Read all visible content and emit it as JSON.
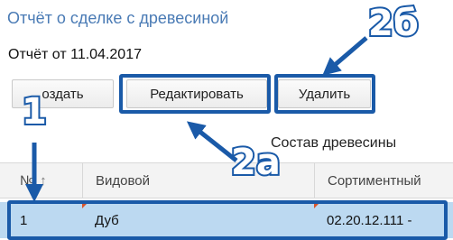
{
  "header": {
    "title": "Отчёт о сделке с древесиной",
    "report_date": "Отчёт от 11.04.2017"
  },
  "toolbar": {
    "create_label": "оздать",
    "edit_label": "Редактировать",
    "delete_label": "Удалить"
  },
  "section": {
    "title": "Состав древесины"
  },
  "table": {
    "columns": [
      "№",
      "Видовой",
      "Сортиментный"
    ],
    "sort_indicator": "↑",
    "rows": [
      {
        "num": "1",
        "species": "Дуб",
        "sortiment": "02.20.12.111 -"
      }
    ]
  },
  "annotations": {
    "label_1": "1",
    "label_2a": "2а",
    "label_2b": "2б",
    "color": "#1a5aa8"
  }
}
